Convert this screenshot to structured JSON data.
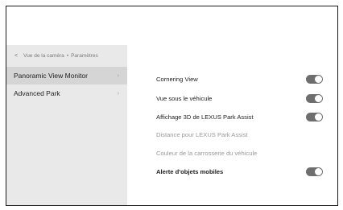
{
  "sidebar": {
    "breadcrumb": {
      "back_glyph": "<",
      "parent": "Vue de la caméra",
      "separator": "•",
      "current": "Paramètres"
    },
    "items": [
      {
        "label": "Panoramic View Monitor",
        "active": true
      },
      {
        "label": "Advanced Park",
        "active": false
      }
    ],
    "chevron_glyph": "›"
  },
  "settings": [
    {
      "label": "Cornering View",
      "toggle": "on",
      "enabled": true
    },
    {
      "label": "Vue sous le véhicule",
      "toggle": "on",
      "enabled": true
    },
    {
      "label": "Affichage 3D de LEXUS Park Assist",
      "toggle": "on",
      "enabled": true
    },
    {
      "label": "Distance pour LEXUS Park Assist",
      "enabled": false
    },
    {
      "label": "Couleur de la carrosserie du véhicule",
      "enabled": false
    },
    {
      "label": "Alerte d'objets mobiles",
      "toggle": "on",
      "enabled": true
    }
  ],
  "colors": {
    "sidebar_bg": "#e9e9e9",
    "active_item_bg": "#d5d5d5",
    "toggle_on": "#6e6e6e",
    "disabled_text": "#9a9a9a"
  }
}
